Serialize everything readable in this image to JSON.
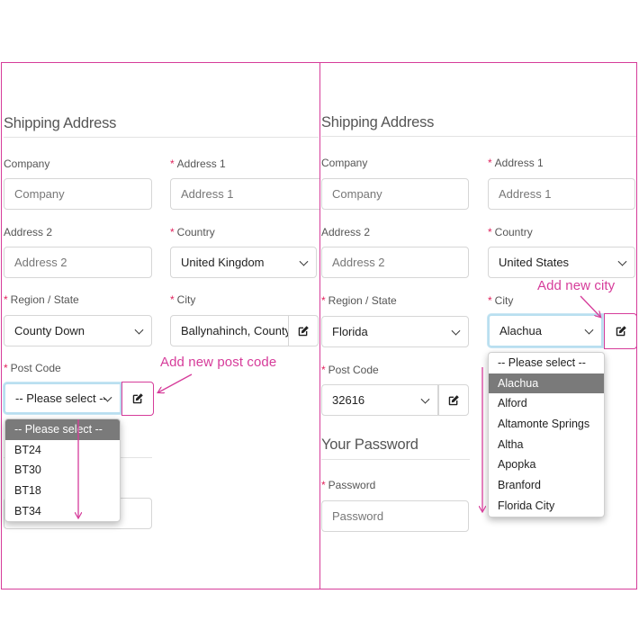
{
  "left": {
    "heading": "Shipping Address",
    "company_label": "Company",
    "company_placeholder": "Company",
    "address1_label": "Address 1",
    "address1_placeholder": "Address 1",
    "address2_label": "Address 2",
    "address2_placeholder": "Address 2",
    "country_label": "Country",
    "country_value": "United Kingdom",
    "region_label": "Region / State",
    "region_value": "County Down",
    "city_label": "City",
    "city_value": "Ballynahinch, County Down",
    "postcode_label": "Post Code",
    "postcode_value": "-- Please select --",
    "postcode_options": [
      "-- Please select --",
      "BT24",
      "BT30",
      "BT18",
      "BT34"
    ],
    "annotation": "Add new post code"
  },
  "right": {
    "heading": "Shipping Address",
    "company_label": "Company",
    "company_placeholder": "Company",
    "address1_label": "Address 1",
    "address1_placeholder": "Address 1",
    "address2_label": "Address 2",
    "address2_placeholder": "Address 2",
    "country_label": "Country",
    "country_value": "United States",
    "region_label": "Region / State",
    "region_value": "Florida",
    "city_label": "City",
    "city_value": "Alachua",
    "city_options": [
      "-- Please select --",
      "Alachua",
      "Alford",
      "Altamonte Springs",
      "Altha",
      "Apopka",
      "Branford",
      "Florida City"
    ],
    "postcode_label": "Post Code",
    "postcode_value": "32616",
    "password_heading": "Your Password",
    "password_label": "Password",
    "password_placeholder": "Password",
    "annotation": "Add new city"
  },
  "required_marker": "*",
  "colors": {
    "annotation": "#d63c9a",
    "required": "#e0245e",
    "selected_option": "#7a7a7a",
    "focus": "#b9dff0"
  },
  "icons": {
    "edit": "edit-square-pen-icon",
    "dropdown": "chevron-down-icon"
  }
}
